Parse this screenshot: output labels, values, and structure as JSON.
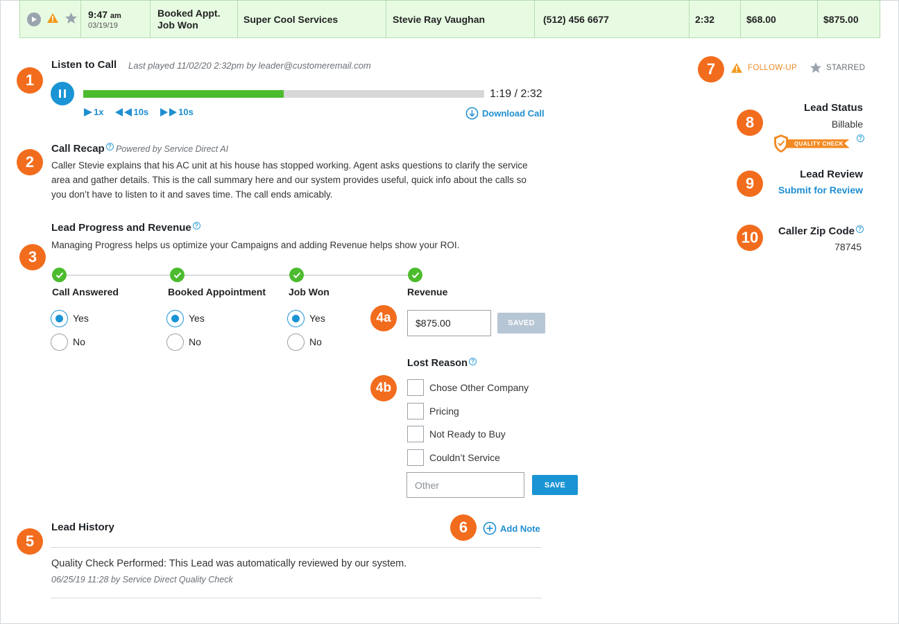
{
  "top_row": {
    "time": "9:47",
    "ampm": "am",
    "date": "03/19/19",
    "status_line1": "Booked Appt.",
    "status_line2": "Job Won",
    "company": "Super Cool Services",
    "caller": "Stevie Ray Vaughan",
    "phone": "(512) 456 6677",
    "duration": "2:32",
    "price": "$68.00",
    "revenue": "$875.00",
    "row_color": "#e7fbe3"
  },
  "badges": {
    "b1": "1",
    "b2": "2",
    "b3": "3",
    "b4a": "4a",
    "b4b": "4b",
    "b5": "5",
    "b6": "6",
    "b7": "7",
    "b8": "8",
    "b9": "9",
    "b10": "10",
    "color": "#f26c1d"
  },
  "listen": {
    "title": "Listen to Call",
    "last_played": "Last played 11/02/20 2:32pm by leader@customeremail.com",
    "progress": 0.5,
    "time_display": "1:19 / 2:32",
    "speed": "1x",
    "back": "10s",
    "forward": "10s",
    "download": "Download Call"
  },
  "recap": {
    "title": "Call Recap",
    "powered": "Powered by Service Direct AI",
    "line1": "Caller Stevie explains that his AC unit at his house has stopped working. Agent asks questions to clarify the service",
    "line2": "area and gather details. This is the call summary here and our system provides useful, quick info about the calls so",
    "line3": "you don’t have to listen to it and saves time. The call ends amicably."
  },
  "progress": {
    "title": "Lead Progress and Revenue",
    "desc": "Managing Progress helps us optimize your Campaigns and adding Revenue helps show your ROI.",
    "steps": [
      {
        "label": "Call Answered",
        "yes": "Yes",
        "no": "No",
        "selected": "Yes"
      },
      {
        "label": "Booked Appointment",
        "yes": "Yes",
        "no": "No",
        "selected": "Yes"
      },
      {
        "label": "Job Won",
        "yes": "Yes",
        "no": "No",
        "selected": "Yes"
      }
    ],
    "revenue_label": "Revenue",
    "revenue_value": "$875.00",
    "saved_button": "SAVED",
    "lost_reason_title": "Lost Reason",
    "lost_reasons": [
      "Chose Other Company",
      "Pricing",
      "Not Ready to Buy",
      "Couldn’t Service"
    ],
    "other_placeholder": "Other",
    "save_button": "SAVE"
  },
  "history": {
    "title": "Lead History",
    "add_note": "Add Note",
    "entry_text": "Quality Check Performed: This Lead was automatically reviewed by our system.",
    "entry_meta": "06/25/19 11:28 by Service Direct Quality Check"
  },
  "flags": {
    "follow_up": "FOLLOW-UP",
    "starred": "STARRED"
  },
  "lead_status": {
    "title": "Lead Status",
    "value": "Billable",
    "quality_check": "QUALITY CHECK"
  },
  "lead_review": {
    "title": "Lead Review",
    "action": "Submit for Review"
  },
  "zip": {
    "title": "Caller Zip Code",
    "value": "78745"
  }
}
